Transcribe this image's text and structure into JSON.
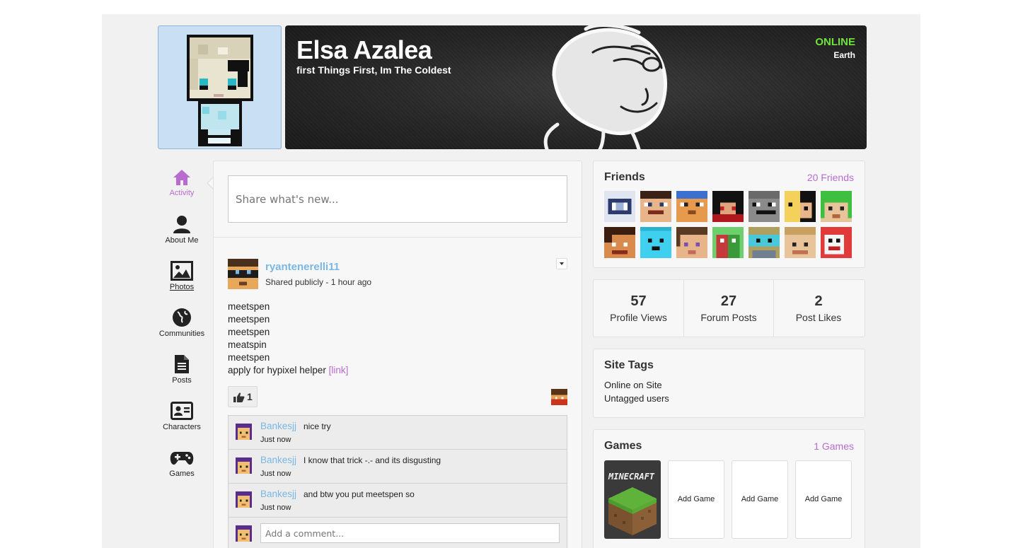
{
  "profile": {
    "name": "Elsa Azalea",
    "motto": "first Things First, Im The Coldest",
    "status": "ONLINE",
    "location": "Earth"
  },
  "nav": {
    "activity": "Activity",
    "about": "About Me",
    "photos": "Photos",
    "communities": "Communities",
    "posts": "Posts",
    "characters": "Characters",
    "games": "Games"
  },
  "share": {
    "placeholder": "Share what's new..."
  },
  "post": {
    "author": "ryantenerelli11",
    "meta": "Shared publicly - 1 hour ago",
    "lines": [
      "meetspen",
      "meetspen",
      "meetspen",
      "meatspin",
      "meetspen"
    ],
    "last_line": "apply for hypixel helper",
    "link_text": "[link]",
    "likes": "1"
  },
  "comments": [
    {
      "author": "Bankesjj",
      "text": "nice try",
      "time": "Just now"
    },
    {
      "author": "Bankesjj",
      "text": "I know that trick -.- and its disgusting",
      "time": "Just now"
    },
    {
      "author": "Bankesjj",
      "text": "and btw you put meetspen so",
      "time": "Just now"
    }
  ],
  "comment_input": {
    "placeholder": "Add a comment..."
  },
  "friends": {
    "title": "Friends",
    "count": "20 Friends"
  },
  "stats": {
    "views": {
      "value": "57",
      "label": "Profile Views"
    },
    "forum": {
      "value": "27",
      "label": "Forum Posts"
    },
    "likes": {
      "value": "2",
      "label": "Post Likes"
    }
  },
  "tags": {
    "title": "Site Tags",
    "items": [
      "Online on Site",
      "Untagged users"
    ]
  },
  "games": {
    "title": "Games",
    "count": "1 Games",
    "featured": "MINECRAFT",
    "add_label": "Add Game"
  },
  "colors": {
    "accent": "#b86cd0",
    "link": "#7ab7e3",
    "online": "#6fe33b"
  }
}
